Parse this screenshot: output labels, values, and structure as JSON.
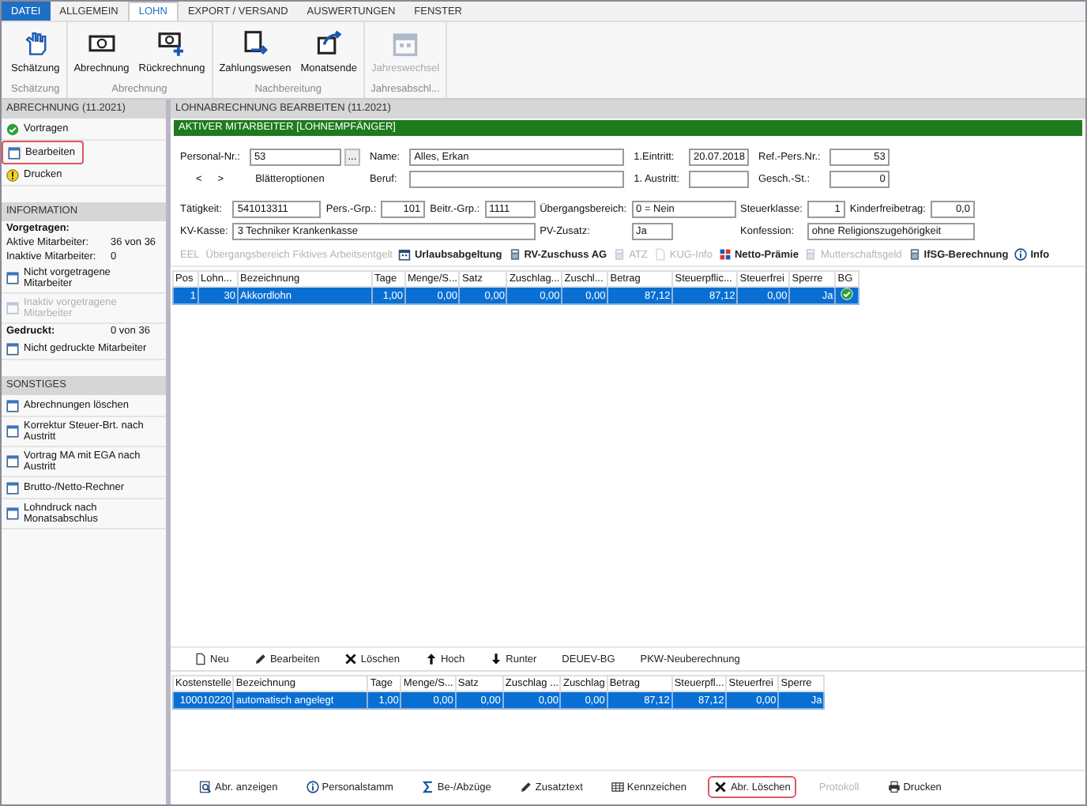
{
  "menu_tabs": [
    {
      "label": "DATEI",
      "kind": "file",
      "selected": false
    },
    {
      "label": "ALLGEMEIN",
      "kind": "tab",
      "selected": false
    },
    {
      "label": "LOHN",
      "kind": "tab",
      "selected": true
    },
    {
      "label": "EXPORT / VERSAND",
      "kind": "tab",
      "selected": false
    },
    {
      "label": "AUSWERTUNGEN",
      "kind": "tab",
      "selected": false
    },
    {
      "label": "FENSTER",
      "kind": "tab",
      "selected": false
    }
  ],
  "ribbon": {
    "groups": [
      {
        "label": "Schätzung",
        "buttons": [
          {
            "label": "Schätzung",
            "kind": "hand",
            "disabled": false
          }
        ]
      },
      {
        "label": "Abrechnung",
        "buttons": [
          {
            "label": "Abrechnung",
            "kind": "money",
            "disabled": false
          },
          {
            "label": "Rückrechnung",
            "kind": "money-plus",
            "disabled": false
          }
        ]
      },
      {
        "label": "Nachbereitung",
        "buttons": [
          {
            "label": "Zahlungswesen",
            "kind": "payment",
            "disabled": false
          },
          {
            "label": "Monatsende",
            "kind": "month",
            "disabled": false
          }
        ]
      },
      {
        "label": "Jahresabschl...",
        "buttons": [
          {
            "label": "Jahreswechsel",
            "kind": "calendar",
            "disabled": true
          }
        ]
      }
    ]
  },
  "sidebar": {
    "sections": [
      {
        "title": "ABRECHNUNG (11.2021)",
        "items": [
          {
            "kind": "done",
            "label": "Vortragen",
            "selected": false,
            "disabled": false
          },
          {
            "kind": "window",
            "label": "Bearbeiten",
            "selected": true,
            "disabled": false
          },
          {
            "kind": "pending",
            "label": "Drucken",
            "selected": false,
            "disabled": false
          }
        ]
      },
      {
        "title": "INFORMATION",
        "items": [
          {
            "kind": "heading",
            "label": "Vorgetragen:"
          },
          {
            "kind": "stat",
            "label": "Aktive Mitarbeiter:",
            "value": "36 von 36"
          },
          {
            "kind": "stat",
            "label": "Inaktive Mitarbeiter:",
            "value": "0"
          },
          {
            "kind": "window",
            "label": "Nicht vorgetragene Mitarbeiter",
            "selected": false,
            "disabled": false
          },
          {
            "kind": "window",
            "label": "Inaktiv vorgetragene Mitarbeiter",
            "selected": false,
            "disabled": true
          },
          {
            "kind": "heading",
            "label": "Gedruckt:",
            "value": "0 von 36"
          },
          {
            "kind": "window",
            "label": "Nicht gedruckte Mitarbeiter",
            "selected": false,
            "disabled": false
          }
        ]
      },
      {
        "title": "SONSTIGES",
        "items": [
          {
            "kind": "window",
            "label": "Abrechnungen löschen",
            "selected": false,
            "disabled": false
          },
          {
            "kind": "window",
            "label": "Korrektur Steuer-Brt. nach Austritt",
            "selected": false,
            "disabled": false
          },
          {
            "kind": "window",
            "label": "Vortrag MA mit EGA nach Austritt",
            "selected": false,
            "disabled": false
          },
          {
            "kind": "window",
            "label": "Brutto-/Netto-Rechner",
            "selected": false,
            "disabled": false
          },
          {
            "kind": "window",
            "label": "Lohndruck nach Monatsabschlus",
            "selected": false,
            "disabled": false
          }
        ]
      }
    ]
  },
  "page_title": "LOHNABRECHNUNG BEARBEITEN (11.2021)",
  "status_banner": "AKTIVER MITARBEITER [LOHNEMPFÄNGER]",
  "employee": {
    "personal_nr": {
      "label": "Personal-Nr.:",
      "value": "53"
    },
    "lookup_button": "...",
    "prev_button": "<",
    "next_button": ">",
    "browse_options": "Blätteroptionen",
    "name": {
      "label": "Name:",
      "value": "Alles, Erkan"
    },
    "beruf": {
      "label": "Beruf:"
    },
    "eintritt": {
      "label": "1.Eintritt:",
      "value": "20.07.2018"
    },
    "austritt": {
      "label": "1. Austritt:"
    },
    "ref_pers_nr": {
      "label": "Ref.-Pers.Nr.:",
      "value": "53"
    },
    "gesch_st": {
      "label": "Gesch.-St.:",
      "value": "0"
    }
  },
  "details": {
    "row1": [
      {
        "label": "Tätigkeit:",
        "value": "541013311",
        "kind": "text"
      },
      {
        "label": "Pers.-Grp.:",
        "value": "101",
        "kind": "number"
      },
      {
        "label": "Beitr.-Grp.:",
        "value": "1111",
        "kind": "text"
      },
      {
        "label": "Übergangsbereich:",
        "value": "0 = Nein",
        "kind": "text"
      },
      {
        "label": "Steuerklasse:",
        "value": "1",
        "kind": "number"
      },
      {
        "label": "Kinderfreibetrag:",
        "value": "0,0",
        "kind": "number"
      }
    ],
    "row2": [
      {
        "label": "KV-Kasse:",
        "value": "3 Techniker Krankenkasse"
      },
      {
        "label": "PV-Zusatz:",
        "value": "Ja"
      },
      {
        "label": "Konfession:",
        "value": "ohne Religionszugehörigkeit"
      }
    ]
  },
  "actions": [
    {
      "label": "EEL",
      "kind": "text",
      "disabled": true
    },
    {
      "label": "Übergangsbereich Fiktives Arbeitsentgelt",
      "kind": "text",
      "disabled": true
    },
    {
      "label": "Urlaubsabgeltung",
      "kind": "calendar",
      "disabled": false
    },
    {
      "label": "RV-Zuschuss AG",
      "kind": "calculator",
      "disabled": false
    },
    {
      "label": "ATZ",
      "kind": "calculator",
      "disabled": true
    },
    {
      "label": "KUG-Info",
      "kind": "document",
      "disabled": true
    },
    {
      "label": "Netto-Prämie",
      "kind": "grid",
      "disabled": false
    },
    {
      "label": "Mutterschaftsgeld",
      "kind": "calculator",
      "disabled": true
    },
    {
      "label": "IfSG-Berechnung",
      "kind": "calculator",
      "disabled": false
    },
    {
      "label": "Info",
      "kind": "info",
      "disabled": false
    }
  ],
  "wage_table": {
    "columns": [
      {
        "label": "Pos",
        "kind": "number"
      },
      {
        "label": "Lohn...",
        "kind": "number"
      },
      {
        "label": "Bezeichnung",
        "kind": "text"
      },
      {
        "label": "Tage",
        "kind": "number"
      },
      {
        "label": "Menge/S...",
        "kind": "number"
      },
      {
        "label": "Satz",
        "kind": "number"
      },
      {
        "label": "Zuschlag...",
        "kind": "number"
      },
      {
        "label": "Zuschl...",
        "kind": "number"
      },
      {
        "label": "Betrag",
        "kind": "number"
      },
      {
        "label": "Steuerpflic...",
        "kind": "number"
      },
      {
        "label": "Steuerfrei",
        "kind": "number"
      },
      {
        "label": "Sperre",
        "kind": "number"
      },
      {
        "label": "BG",
        "kind": "check"
      }
    ],
    "rows": [
      {
        "selected": true,
        "bg_checked": true,
        "cells": [
          "1",
          "30",
          "Akkordlohn",
          "1,00",
          "0,00",
          "0,00",
          "0,00",
          "0,00",
          "87,12",
          "87,12",
          "0,00",
          "Ja"
        ]
      }
    ]
  },
  "row_actions": [
    {
      "label": "Neu",
      "kind": "page"
    },
    {
      "label": "Bearbeiten",
      "kind": "pencil"
    },
    {
      "label": "Löschen",
      "kind": "cross"
    },
    {
      "label": "Hoch",
      "kind": "up"
    },
    {
      "label": "Runter",
      "kind": "down"
    },
    {
      "label": "DEUEV-BG",
      "kind": "text"
    },
    {
      "label": "PKW-Neuberechnung",
      "kind": "text"
    }
  ],
  "cost_table": {
    "columns": [
      {
        "label": "Kostenstelle",
        "kind": "number"
      },
      {
        "label": "Bezeichnung",
        "kind": "text"
      },
      {
        "label": "Tage",
        "kind": "number"
      },
      {
        "label": "Menge/S...",
        "kind": "number"
      },
      {
        "label": "Satz",
        "kind": "number"
      },
      {
        "label": "Zuschlag ...",
        "kind": "number"
      },
      {
        "label": "Zuschlag",
        "kind": "number"
      },
      {
        "label": "Betrag",
        "kind": "number"
      },
      {
        "label": "Steuerpfl...",
        "kind": "number"
      },
      {
        "label": "Steuerfrei",
        "kind": "number"
      },
      {
        "label": "Sperre",
        "kind": "number"
      }
    ],
    "rows": [
      {
        "selected": true,
        "cells": [
          "100010220",
          "automatisch angelegt",
          "1,00",
          "0,00",
          "0,00",
          "0,00",
          "0,00",
          "87,12",
          "87,12",
          "0,00",
          "Ja"
        ]
      }
    ]
  },
  "bottom_actions": [
    {
      "label": "Abr. anzeigen",
      "kind": "magnifier",
      "selected": false,
      "disabled": false
    },
    {
      "label": "Personalstamm",
      "kind": "info",
      "selected": false,
      "disabled": false
    },
    {
      "label": "Be-/Abzüge",
      "kind": "sigma",
      "selected": false,
      "disabled": false
    },
    {
      "label": "Zusatztext",
      "kind": "pencil",
      "selected": false,
      "disabled": false
    },
    {
      "label": "Kennzeichen",
      "kind": "table",
      "selected": false,
      "disabled": false
    },
    {
      "label": "Abr. Löschen",
      "kind": "cross",
      "selected": true,
      "disabled": false
    },
    {
      "label": "Protokoll",
      "kind": "text",
      "selected": false,
      "disabled": true
    },
    {
      "label": "Drucken",
      "kind": "printer",
      "selected": false,
      "disabled": false
    }
  ]
}
